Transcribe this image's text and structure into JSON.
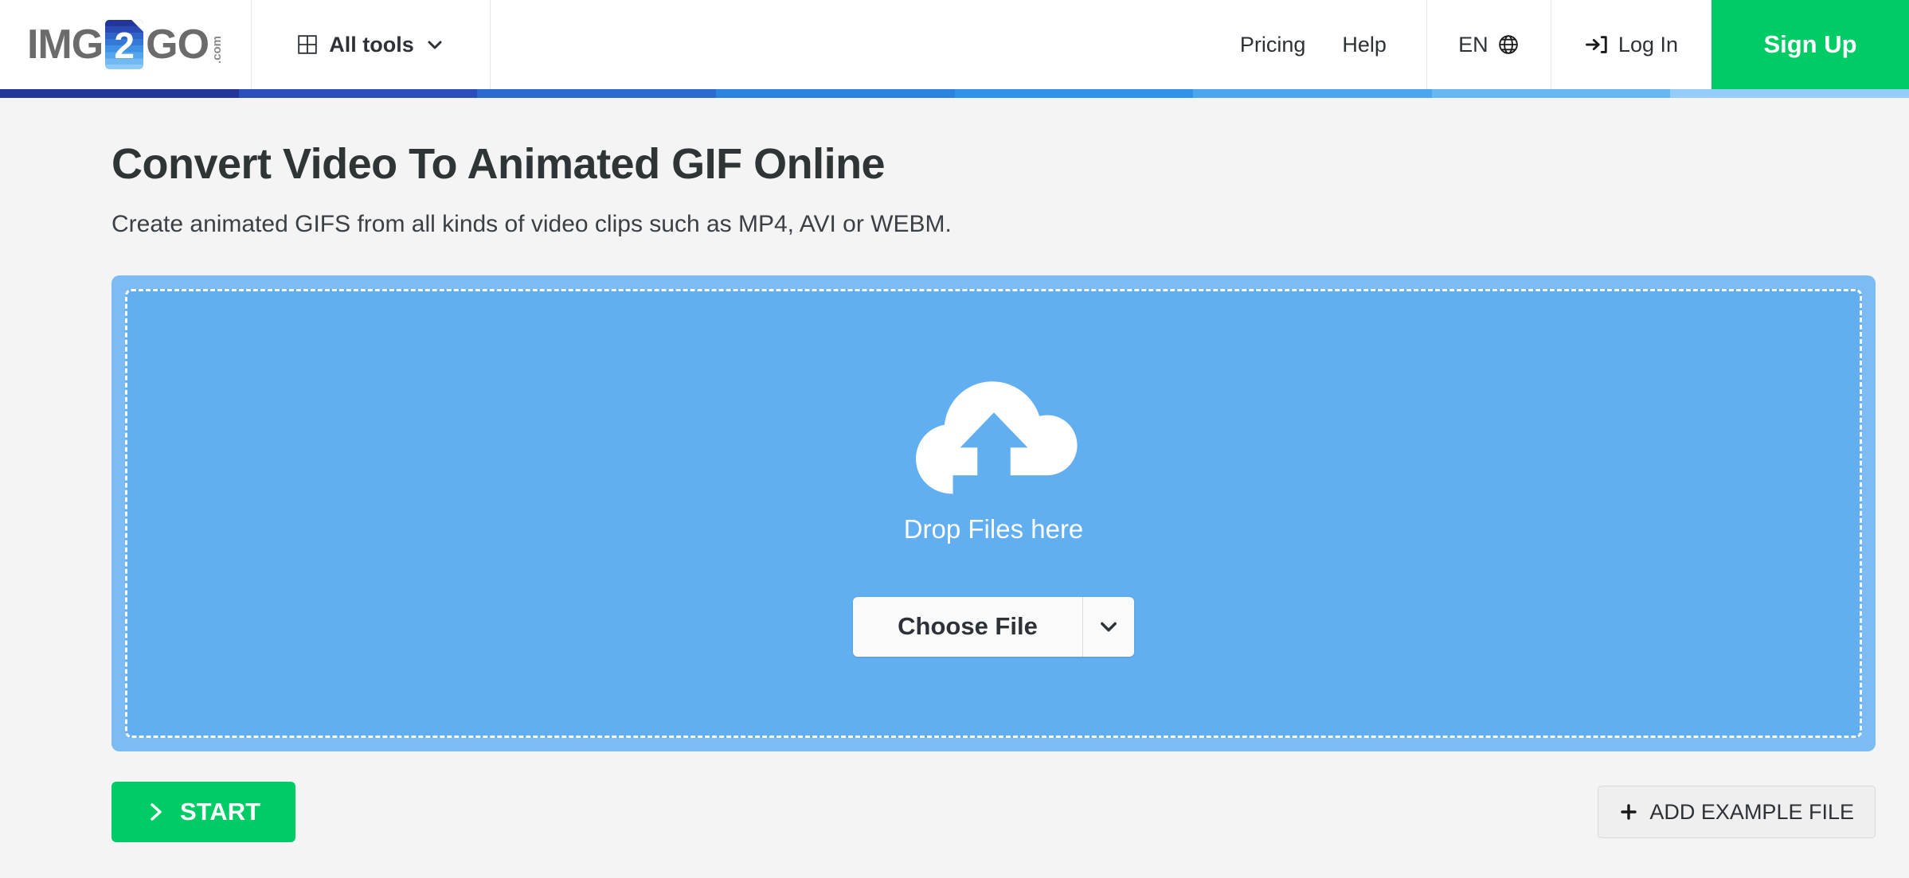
{
  "header": {
    "logo": {
      "text_left": "IMG",
      "doc_char": "2",
      "text_right": "GO",
      "suffix": ".com"
    },
    "tools": {
      "label": "All tools",
      "icon": "grid-icon",
      "caret": "chevron-down-icon"
    },
    "links": [
      {
        "label": "Pricing"
      },
      {
        "label": "Help"
      }
    ],
    "language": {
      "label": "EN",
      "icon": "globe-icon"
    },
    "login": {
      "label": "Log In",
      "icon": "sign-in-icon"
    },
    "signup": {
      "label": "Sign Up"
    }
  },
  "gradient_bar": {
    "colors": [
      "#22359b",
      "#2a4fbb",
      "#2b6bce",
      "#2a83e0",
      "#2f93ea",
      "#4aa7ef",
      "#66b8f3",
      "#93cdf8"
    ]
  },
  "main": {
    "title": "Convert Video To Animated GIF Online",
    "subtitle": "Create animated GIFS from all kinds of video clips such as MP4, AVI or WEBM.",
    "dropzone": {
      "icon": "cloud-upload-icon",
      "drop_text": "Drop Files here",
      "choose_file_label": "Choose File",
      "choose_caret": "chevron-down-icon"
    },
    "actions": {
      "start_label": "START",
      "start_icon": "chevron-right-icon",
      "example_label": "ADD EXAMPLE FILE",
      "example_icon": "plus-icon"
    }
  },
  "colors": {
    "brand_green": "#00cc66",
    "dropzone_outer": "#7cbcf2",
    "dropzone_inner": "#61aef0",
    "page_background": "#f4f4f4",
    "text_dark": "#2c3237"
  }
}
